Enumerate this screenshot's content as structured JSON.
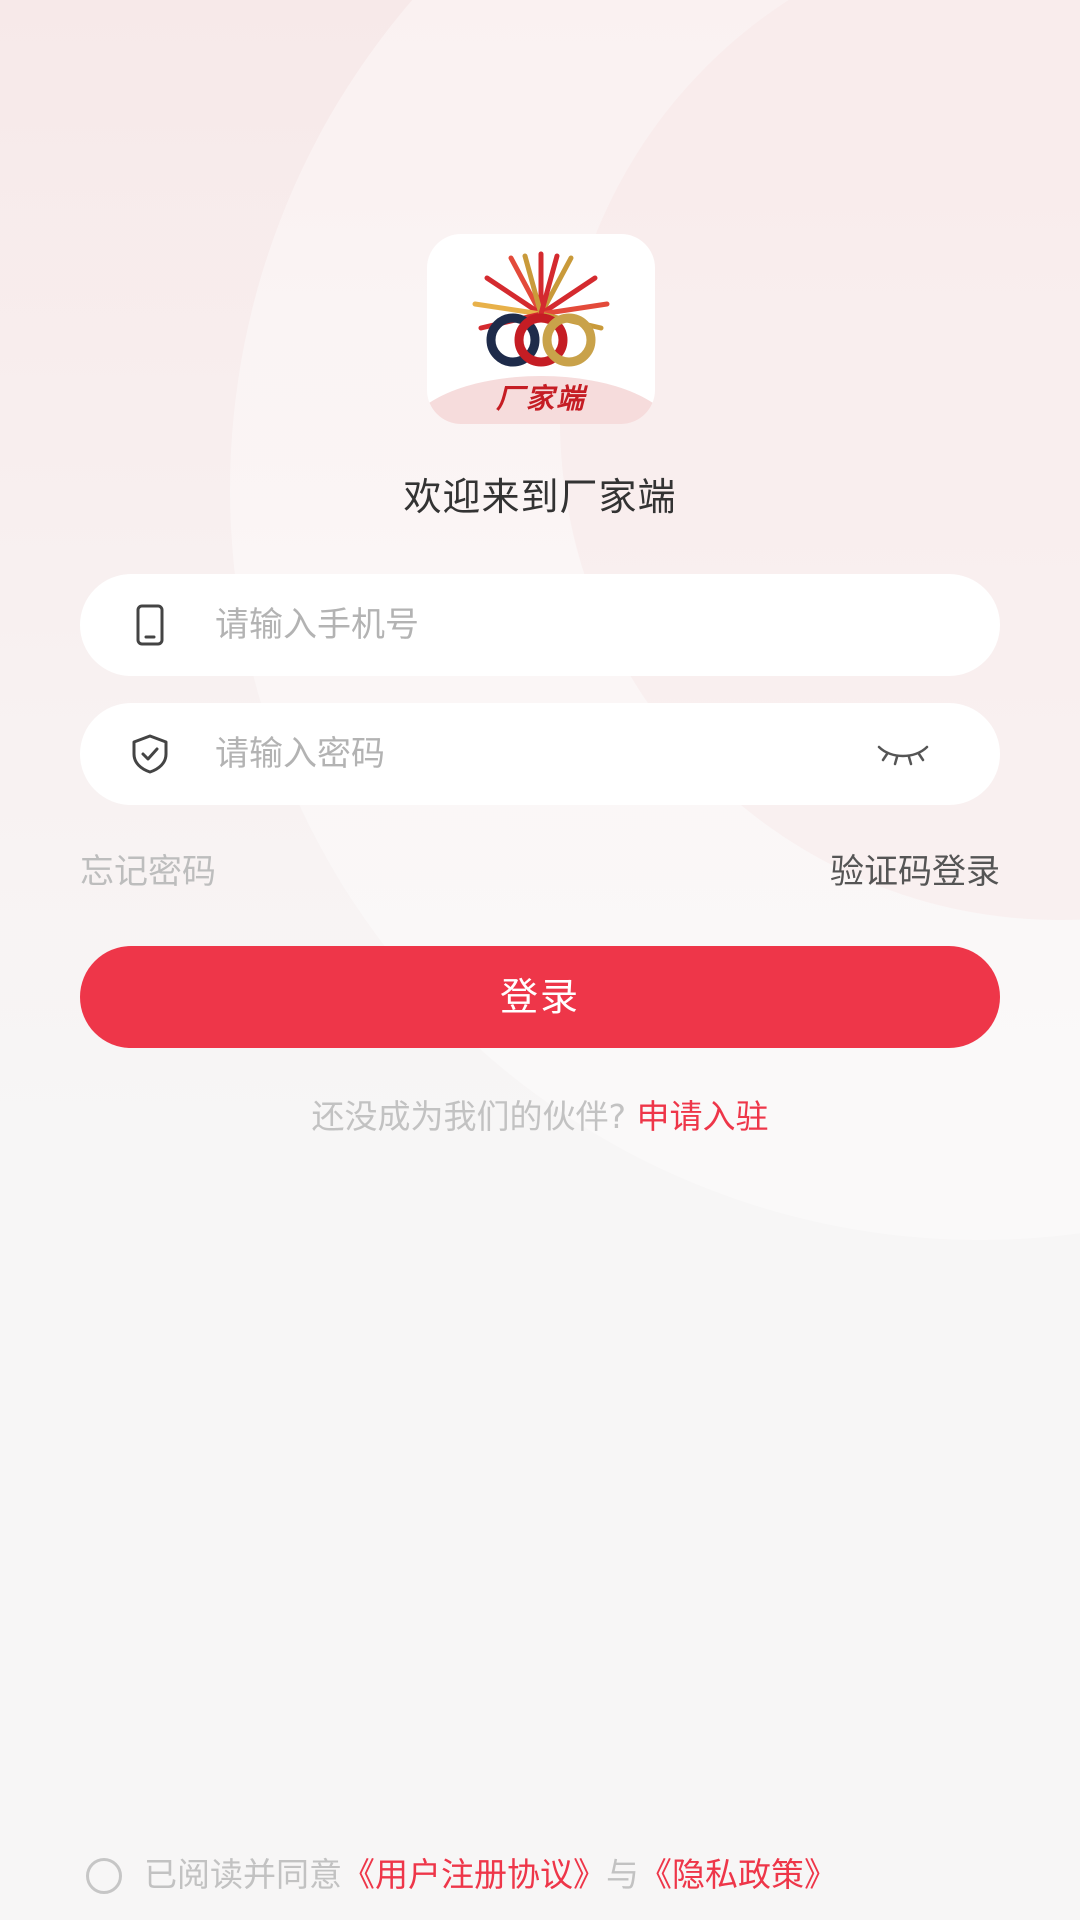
{
  "logo": {
    "text": "厂家端"
  },
  "welcome_title": "欢迎来到厂家端",
  "phone_input": {
    "placeholder": "请输入手机号",
    "value": ""
  },
  "password_input": {
    "placeholder": "请输入密码",
    "value": ""
  },
  "links": {
    "forgot_password": "忘记密码",
    "code_login": "验证码登录"
  },
  "login_button": "登录",
  "partner": {
    "prompt": "还没成为我们的伙伴?",
    "apply": "申请入驻"
  },
  "agreement": {
    "prefix": "已阅读并同意",
    "user_agreement": "《用户注册协议》",
    "and": "与",
    "privacy_policy": "《隐私政策》",
    "checked": false
  },
  "colors": {
    "brand_red": "#ee3649",
    "logo_red": "#c51d24"
  },
  "icons": {
    "phone": "phone-icon",
    "password": "shield-check-icon",
    "eye": "eye-closed-icon",
    "checkbox": "radio-circle-icon"
  }
}
